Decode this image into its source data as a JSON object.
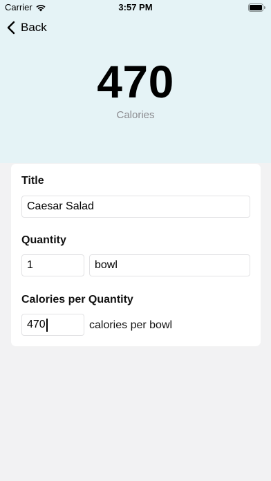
{
  "status_bar": {
    "carrier": "Carrier",
    "time": "3:57 PM"
  },
  "nav": {
    "back_label": "Back"
  },
  "summary": {
    "calories": "470",
    "calories_label": "Calories"
  },
  "form": {
    "title_label": "Title",
    "title_value": "Caesar Salad",
    "quantity_label": "Quantity",
    "quantity_value": "1",
    "unit_value": "bowl",
    "calories_per_quantity_label": "Calories per Quantity",
    "calories_per_quantity_value": "470",
    "calories_unit_text": "calories per bowl"
  },
  "colors": {
    "header_background": "#e5f3f6",
    "page_background": "#f2f2f3",
    "card_background": "#ffffff",
    "secondary_text": "#8a8a8e"
  },
  "icons": [
    "wifi-icon",
    "battery-icon",
    "chevron-left-icon"
  ]
}
